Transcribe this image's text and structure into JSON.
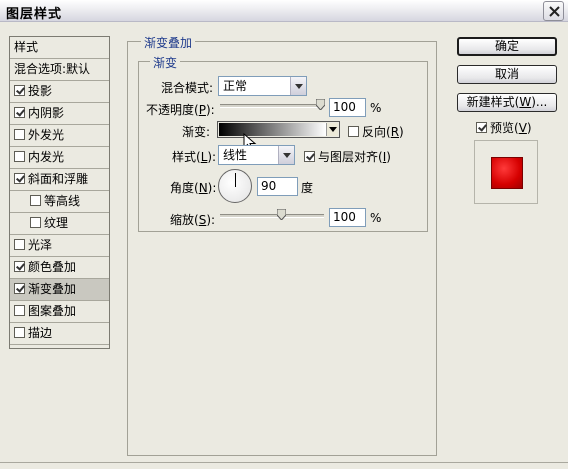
{
  "window": {
    "title": "图层样式",
    "close_icon": "close-x-icon"
  },
  "sidebar": {
    "items": [
      {
        "label": "样式",
        "checkbox": false,
        "checked": false,
        "selected": false,
        "indent": false
      },
      {
        "label": "混合选项:默认",
        "checkbox": false,
        "checked": false,
        "selected": false,
        "indent": false
      },
      {
        "label": "投影",
        "checkbox": true,
        "checked": true,
        "selected": false,
        "indent": false
      },
      {
        "label": "内阴影",
        "checkbox": true,
        "checked": true,
        "selected": false,
        "indent": false
      },
      {
        "label": "外发光",
        "checkbox": true,
        "checked": false,
        "selected": false,
        "indent": false
      },
      {
        "label": "内发光",
        "checkbox": true,
        "checked": false,
        "selected": false,
        "indent": false
      },
      {
        "label": "斜面和浮雕",
        "checkbox": true,
        "checked": true,
        "selected": false,
        "indent": false
      },
      {
        "label": "等高线",
        "checkbox": true,
        "checked": false,
        "selected": false,
        "indent": true
      },
      {
        "label": "纹理",
        "checkbox": true,
        "checked": false,
        "selected": false,
        "indent": true
      },
      {
        "label": "光泽",
        "checkbox": true,
        "checked": false,
        "selected": false,
        "indent": false
      },
      {
        "label": "颜色叠加",
        "checkbox": true,
        "checked": true,
        "selected": false,
        "indent": false
      },
      {
        "label": "渐变叠加",
        "checkbox": true,
        "checked": true,
        "selected": true,
        "indent": false
      },
      {
        "label": "图案叠加",
        "checkbox": true,
        "checked": false,
        "selected": false,
        "indent": false
      },
      {
        "label": "描边",
        "checkbox": true,
        "checked": false,
        "selected": false,
        "indent": false
      }
    ]
  },
  "panel": {
    "group_title": "渐变叠加",
    "subgroup_title": "渐变",
    "blend_mode": {
      "label": "混合模式:",
      "value": "正常"
    },
    "opacity": {
      "label_pre": "不透明度(",
      "hotkey": "P",
      "label_post": "):",
      "value": "100",
      "unit": "%",
      "level": 1.0
    },
    "gradient": {
      "label": "渐变:",
      "reverse_label_pre": "反向(",
      "reverse_hotkey": "R",
      "reverse_label_post": ")",
      "reverse_checked": false
    },
    "style": {
      "label_pre": "样式(",
      "hotkey": "L",
      "label_post": "):",
      "value": "线性",
      "align_label_pre": "与图层对齐(",
      "align_hotkey": "I",
      "align_label_post": ")",
      "align_checked": true
    },
    "angle": {
      "label_pre": "角度(",
      "hotkey": "N",
      "label_post": "):",
      "value": "90",
      "unit": "度"
    },
    "scale": {
      "label_pre": "缩放(",
      "hotkey": "S",
      "label_post": "):",
      "value": "100",
      "unit": "%",
      "level": 0.5
    }
  },
  "buttons": {
    "ok": "确定",
    "cancel": "取消",
    "new_style_pre": "新建样式(",
    "new_style_hotkey": "W",
    "new_style_post": ")...",
    "preview_pre": "预览(",
    "preview_hotkey": "V",
    "preview_post": ")",
    "preview_checked": true
  },
  "colors": {
    "preview_swatch": "#d50000",
    "accent_legend": "#1f3b8c"
  }
}
